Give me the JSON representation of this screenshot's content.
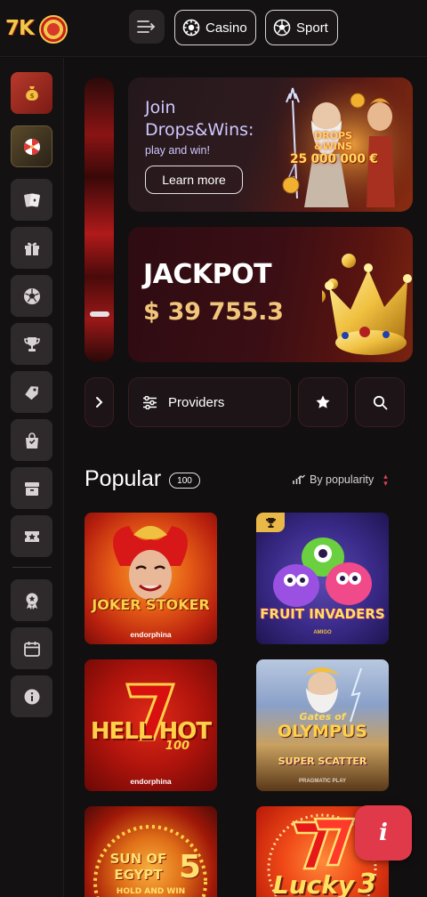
{
  "header": {
    "logo_text": "7K",
    "casino_label": "Casino",
    "sport_label": "Sport"
  },
  "sidebar": {
    "items": [
      {
        "icon": "money-bag-icon",
        "state": "active-red"
      },
      {
        "icon": "wheel-icon",
        "state": "active-gold"
      },
      {
        "icon": "cards-icon"
      },
      {
        "icon": "gift-icon"
      },
      {
        "icon": "soccer-ball-icon"
      },
      {
        "icon": "trophy-icon"
      },
      {
        "icon": "ticket-icon"
      },
      {
        "icon": "shopping-bag-icon"
      },
      {
        "icon": "archive-box-icon"
      },
      {
        "icon": "star-ticket-icon"
      },
      {
        "icon": "badge-icon"
      },
      {
        "icon": "calendar-icon"
      },
      {
        "icon": "info-icon"
      }
    ]
  },
  "banners": {
    "promo": {
      "title": "Join Drops&Wins:",
      "subtitle": "play and win!",
      "button": "Learn more",
      "art_line1": "DROPS",
      "art_line2": "&WINS",
      "art_amount": "25 000 000 €"
    },
    "jackpot": {
      "title": "JACKPOT",
      "amount": "$ 39 755.3"
    }
  },
  "controls": {
    "providers_label": "Providers"
  },
  "section": {
    "title": "Popular",
    "count": "100",
    "sort_label": "By popularity"
  },
  "games": [
    {
      "name": "JOKER STOKER",
      "provider": "endorphina"
    },
    {
      "name": "FRUIT INVADERS",
      "provider": "AMIGO"
    },
    {
      "name_top": "HELL HOT",
      "name_num": "100",
      "provider": "endorphina"
    },
    {
      "name_top": "Gates of",
      "name_main": "OLYMPUS",
      "name_sub": "SUPER SCATTER",
      "provider": "PRAGMATIC PLAY"
    },
    {
      "name_top": "SUN OF",
      "name_main": "EGYPT",
      "name_num": "5",
      "name_sub": "HOLD AND WIN"
    },
    {
      "name_main": "Lucky",
      "name_num": "3"
    }
  ],
  "colors": {
    "background": "#120f10",
    "accent_red": "#e03a4a",
    "jackpot_gold": "#f2c67a",
    "promo_text": "#cfc8ff"
  },
  "fab_label": "i"
}
